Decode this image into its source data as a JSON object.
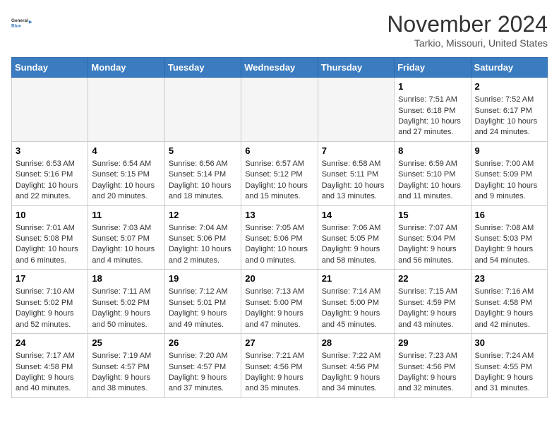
{
  "header": {
    "logo_line1": "General",
    "logo_line2": "Blue",
    "month_title": "November 2024",
    "location": "Tarkio, Missouri, United States"
  },
  "weekdays": [
    "Sunday",
    "Monday",
    "Tuesday",
    "Wednesday",
    "Thursday",
    "Friday",
    "Saturday"
  ],
  "weeks": [
    [
      {
        "day": "",
        "info": "",
        "empty": true
      },
      {
        "day": "",
        "info": "",
        "empty": true
      },
      {
        "day": "",
        "info": "",
        "empty": true
      },
      {
        "day": "",
        "info": "",
        "empty": true
      },
      {
        "day": "",
        "info": "",
        "empty": true
      },
      {
        "day": "1",
        "info": "Sunrise: 7:51 AM\nSunset: 6:18 PM\nDaylight: 10 hours\nand 27 minutes."
      },
      {
        "day": "2",
        "info": "Sunrise: 7:52 AM\nSunset: 6:17 PM\nDaylight: 10 hours\nand 24 minutes."
      }
    ],
    [
      {
        "day": "3",
        "info": "Sunrise: 6:53 AM\nSunset: 5:16 PM\nDaylight: 10 hours\nand 22 minutes."
      },
      {
        "day": "4",
        "info": "Sunrise: 6:54 AM\nSunset: 5:15 PM\nDaylight: 10 hours\nand 20 minutes."
      },
      {
        "day": "5",
        "info": "Sunrise: 6:56 AM\nSunset: 5:14 PM\nDaylight: 10 hours\nand 18 minutes."
      },
      {
        "day": "6",
        "info": "Sunrise: 6:57 AM\nSunset: 5:12 PM\nDaylight: 10 hours\nand 15 minutes."
      },
      {
        "day": "7",
        "info": "Sunrise: 6:58 AM\nSunset: 5:11 PM\nDaylight: 10 hours\nand 13 minutes."
      },
      {
        "day": "8",
        "info": "Sunrise: 6:59 AM\nSunset: 5:10 PM\nDaylight: 10 hours\nand 11 minutes."
      },
      {
        "day": "9",
        "info": "Sunrise: 7:00 AM\nSunset: 5:09 PM\nDaylight: 10 hours\nand 9 minutes."
      }
    ],
    [
      {
        "day": "10",
        "info": "Sunrise: 7:01 AM\nSunset: 5:08 PM\nDaylight: 10 hours\nand 6 minutes."
      },
      {
        "day": "11",
        "info": "Sunrise: 7:03 AM\nSunset: 5:07 PM\nDaylight: 10 hours\nand 4 minutes."
      },
      {
        "day": "12",
        "info": "Sunrise: 7:04 AM\nSunset: 5:06 PM\nDaylight: 10 hours\nand 2 minutes."
      },
      {
        "day": "13",
        "info": "Sunrise: 7:05 AM\nSunset: 5:06 PM\nDaylight: 10 hours\nand 0 minutes."
      },
      {
        "day": "14",
        "info": "Sunrise: 7:06 AM\nSunset: 5:05 PM\nDaylight: 9 hours\nand 58 minutes."
      },
      {
        "day": "15",
        "info": "Sunrise: 7:07 AM\nSunset: 5:04 PM\nDaylight: 9 hours\nand 56 minutes."
      },
      {
        "day": "16",
        "info": "Sunrise: 7:08 AM\nSunset: 5:03 PM\nDaylight: 9 hours\nand 54 minutes."
      }
    ],
    [
      {
        "day": "17",
        "info": "Sunrise: 7:10 AM\nSunset: 5:02 PM\nDaylight: 9 hours\nand 52 minutes."
      },
      {
        "day": "18",
        "info": "Sunrise: 7:11 AM\nSunset: 5:02 PM\nDaylight: 9 hours\nand 50 minutes."
      },
      {
        "day": "19",
        "info": "Sunrise: 7:12 AM\nSunset: 5:01 PM\nDaylight: 9 hours\nand 49 minutes."
      },
      {
        "day": "20",
        "info": "Sunrise: 7:13 AM\nSunset: 5:00 PM\nDaylight: 9 hours\nand 47 minutes."
      },
      {
        "day": "21",
        "info": "Sunrise: 7:14 AM\nSunset: 5:00 PM\nDaylight: 9 hours\nand 45 minutes."
      },
      {
        "day": "22",
        "info": "Sunrise: 7:15 AM\nSunset: 4:59 PM\nDaylight: 9 hours\nand 43 minutes."
      },
      {
        "day": "23",
        "info": "Sunrise: 7:16 AM\nSunset: 4:58 PM\nDaylight: 9 hours\nand 42 minutes."
      }
    ],
    [
      {
        "day": "24",
        "info": "Sunrise: 7:17 AM\nSunset: 4:58 PM\nDaylight: 9 hours\nand 40 minutes."
      },
      {
        "day": "25",
        "info": "Sunrise: 7:19 AM\nSunset: 4:57 PM\nDaylight: 9 hours\nand 38 minutes."
      },
      {
        "day": "26",
        "info": "Sunrise: 7:20 AM\nSunset: 4:57 PM\nDaylight: 9 hours\nand 37 minutes."
      },
      {
        "day": "27",
        "info": "Sunrise: 7:21 AM\nSunset: 4:56 PM\nDaylight: 9 hours\nand 35 minutes."
      },
      {
        "day": "28",
        "info": "Sunrise: 7:22 AM\nSunset: 4:56 PM\nDaylight: 9 hours\nand 34 minutes."
      },
      {
        "day": "29",
        "info": "Sunrise: 7:23 AM\nSunset: 4:56 PM\nDaylight: 9 hours\nand 32 minutes."
      },
      {
        "day": "30",
        "info": "Sunrise: 7:24 AM\nSunset: 4:55 PM\nDaylight: 9 hours\nand 31 minutes."
      }
    ]
  ]
}
